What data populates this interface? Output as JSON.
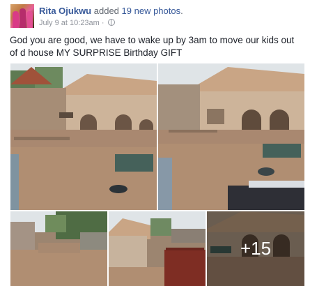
{
  "post": {
    "author": "Rita Ojukwu",
    "action": "added",
    "action_link": "19 new photos",
    "action_suffix": ".",
    "date": "July 9 at 10:23am",
    "separator": "·",
    "privacy_icon": "globe-icon",
    "text": "God you are good, we have to wake up by 3am to move our kids out of d house MY SURPRISE Birthday GIFT"
  },
  "photos": {
    "count_shown": 5,
    "more_label": "+15"
  },
  "colors": {
    "link": "#365899",
    "meta": "#90949c",
    "flood_water": "#b08e72",
    "roof": "#c9a585"
  }
}
